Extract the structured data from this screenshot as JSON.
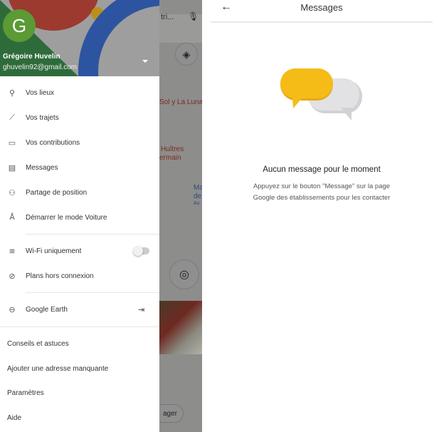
{
  "map": {
    "labels": [
      "tri...",
      "Sol y La Luna",
      "Huîtres",
      "ermain",
      "Ma",
      "de",
      "Au"
    ],
    "share_button_fragment": "ager"
  },
  "drawer": {
    "avatar_letter": "G",
    "user_name": "Grégoire Huvelin",
    "user_email": "ghuvelin92@gmail.com",
    "items": [
      {
        "label": "Vos lieux",
        "icon": "location-pin-icon"
      },
      {
        "label": "Vos trajets",
        "icon": "timeline-icon"
      },
      {
        "label": "Vos contributions",
        "icon": "contributions-icon"
      },
      {
        "label": "Messages",
        "icon": "message-icon"
      },
      {
        "label": "Partage de position",
        "icon": "location-sharing-icon"
      },
      {
        "label": "Démarrer le mode Voiture",
        "icon": "navigation-icon"
      }
    ],
    "wifi": {
      "label": "Wi-Fi uniquement",
      "enabled": false
    },
    "offline": {
      "label": "Plans hors connexion"
    },
    "earth": {
      "label": "Google Earth"
    },
    "footer_items": [
      "Conseils et astuces",
      "Ajouter une adresse manquante",
      "Paramètres",
      "Aide"
    ]
  },
  "messages": {
    "title": "Messages",
    "empty_title": "Aucun message pour le moment",
    "empty_line1": "Appuyez sur le bouton \"Message\" sur la page",
    "empty_line2": "Google des établissements pour les contacter",
    "colors": {
      "yellow_bubble": "#F5BC18",
      "grey_bubble": "#E0E0E3"
    }
  }
}
